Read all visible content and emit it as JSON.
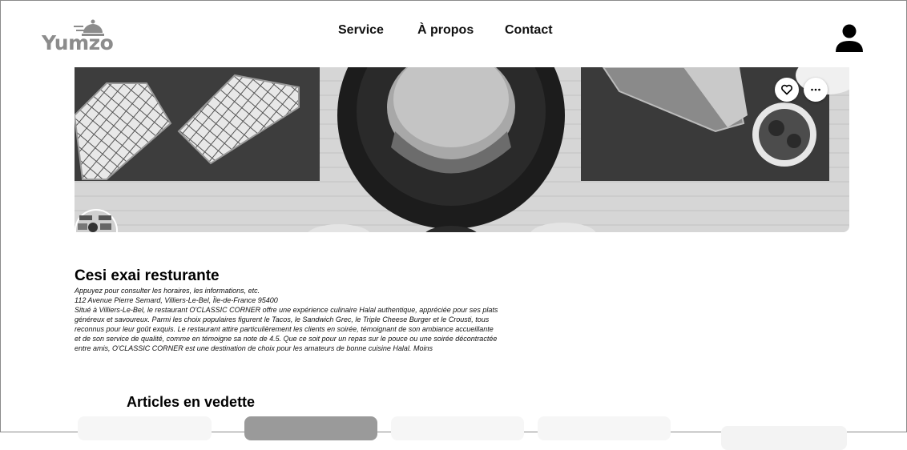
{
  "header": {
    "logo_text": "Yumzo",
    "nav": [
      "Service",
      "À propos",
      "Contact"
    ],
    "user_icon": "user-icon"
  },
  "banner": {
    "actions": {
      "favorite_icon": "heart-icon",
      "more_icon": "more-icon"
    }
  },
  "restaurant": {
    "name": "Cesi exai resturante",
    "hint": "Appuyez pour consulter les horaires, les informations, etc.",
    "address": "112 Avenue Pierre Semard, Villiers-Le-Bel, Île-de-France 95400",
    "description": "Situé à Villiers-Le-Bel, le restaurant O'CLASSIC CORNER offre une expérience culinaire Halal authentique, appréciée pour ses plats généreux et savoureux. Parmi les choix populaires figurent le Tacos, le Sandwich Grec, le Triple Cheese Burger et le Crousti, tous reconnus pour leur goût exquis. Le restaurant attire particulièrement les clients en soirée, témoignant de son ambiance accueillante et de son service de qualité, comme en témoigne sa note de 4.5. Que ce soit pour un repas sur le pouce ou une soirée décontractée entre amis, O'CLASSIC CORNER est une destination de choix pour les amateurs de bonne cuisine Halal.",
    "more_label": "Moins"
  },
  "featured": {
    "title": "Articles en vedette"
  }
}
